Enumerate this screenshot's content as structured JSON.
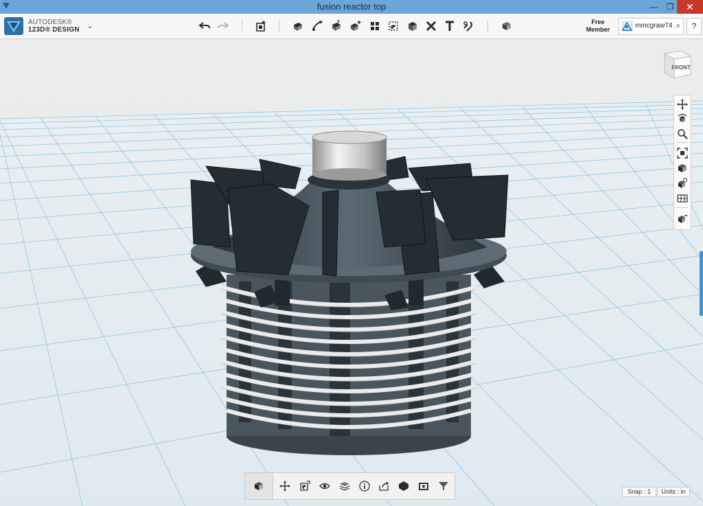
{
  "window": {
    "title": "fusion reactor top",
    "minimize": "—",
    "maximize": "❐",
    "close": "✕"
  },
  "brand": {
    "line1": "AUTODESK®",
    "line2": "123D® DESIGN",
    "menu_caret": "⌄"
  },
  "account": {
    "membership": "Free Member",
    "username": "mmcgraw74 ...",
    "caret": "⌄",
    "help": "?"
  },
  "viewcube": {
    "face": "FRONT"
  },
  "status": {
    "snap": "Snap : 1",
    "units": "Units : in"
  },
  "icons": {
    "toolbar": [
      "undo-icon",
      "redo-icon",
      "primitives-icon",
      "sketch-icon",
      "construct-icon",
      "modify-icon",
      "pattern-icon",
      "group-icon",
      "combine-icon",
      "measure-icon",
      "delete-icon",
      "text-icon",
      "snap-icon",
      "materials-icon"
    ],
    "navigation": [
      "pan-icon",
      "orbit-icon",
      "zoom-icon",
      "fit-icon",
      "perspective-icon",
      "visibility-icon",
      "grid-icon",
      "materials-view-icon"
    ],
    "bottom": [
      "select-icon",
      "move-icon",
      "smart-scale-icon",
      "eye-icon",
      "layers-icon",
      "info-icon",
      "export-icon",
      "solid-icon",
      "camera-icon",
      "filter-icon"
    ]
  },
  "colors": {
    "accent": "#3d93d4",
    "titlebar": "#6aa6d8",
    "close": "#c7392a",
    "grid": "#7cc3e6",
    "model_dark": "#2f3a42",
    "coil": "#e8e8e8"
  }
}
